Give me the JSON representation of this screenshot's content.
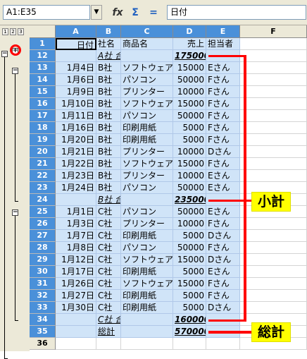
{
  "toolbar": {
    "name_box": "A1:E35",
    "function_wizard_icon": "fx-icon",
    "sum_icon": "sigma-icon",
    "equals_icon": "equals-icon",
    "sum_glyph": "Σ",
    "equals_glyph": "=",
    "fx_glyph": "fx",
    "formula_value": "日付"
  },
  "outline": {
    "levels": [
      "1",
      "2",
      "3"
    ],
    "collapse_glyph": "−",
    "expand_glyph": "+"
  },
  "columns": [
    "A",
    "B",
    "C",
    "D",
    "E",
    "F"
  ],
  "rows": [
    {
      "num": "1",
      "cells": [
        "日付",
        "社名",
        "商品名",
        "売上",
        "担当者"
      ]
    },
    {
      "num": "12",
      "cells": [
        "",
        "A社 合計",
        "",
        "175000",
        ""
      ]
    },
    {
      "num": "13",
      "cells": [
        "1月4日",
        "B社",
        "ソフトウェア",
        "15000",
        "Eさん"
      ]
    },
    {
      "num": "14",
      "cells": [
        "1月6日",
        "B社",
        "パソコン",
        "50000",
        "Fさん"
      ]
    },
    {
      "num": "15",
      "cells": [
        "1月9日",
        "B社",
        "プリンター",
        "10000",
        "Fさん"
      ]
    },
    {
      "num": "16",
      "cells": [
        "1月10日",
        "B社",
        "ソフトウェア",
        "15000",
        "Fさん"
      ]
    },
    {
      "num": "17",
      "cells": [
        "1月11日",
        "B社",
        "パソコン",
        "50000",
        "Fさん"
      ]
    },
    {
      "num": "18",
      "cells": [
        "1月16日",
        "B社",
        "印刷用紙",
        "5000",
        "Fさん"
      ]
    },
    {
      "num": "19",
      "cells": [
        "1月20日",
        "B社",
        "印刷用紙",
        "5000",
        "Fさん"
      ]
    },
    {
      "num": "20",
      "cells": [
        "1月21日",
        "B社",
        "プリンター",
        "10000",
        "Dさん"
      ]
    },
    {
      "num": "21",
      "cells": [
        "1月22日",
        "B社",
        "ソフトウェア",
        "15000",
        "Fさん"
      ]
    },
    {
      "num": "22",
      "cells": [
        "1月23日",
        "B社",
        "プリンター",
        "10000",
        "Eさん"
      ]
    },
    {
      "num": "23",
      "cells": [
        "1月24日",
        "B社",
        "パソコン",
        "50000",
        "Eさん"
      ]
    },
    {
      "num": "24",
      "cells": [
        "",
        "B社 合計",
        "",
        "235000",
        ""
      ]
    },
    {
      "num": "25",
      "cells": [
        "1月1日",
        "C社",
        "パソコン",
        "50000",
        "Eさん"
      ]
    },
    {
      "num": "26",
      "cells": [
        "1月3日",
        "C社",
        "プリンター",
        "10000",
        "Fさん"
      ]
    },
    {
      "num": "27",
      "cells": [
        "1月7日",
        "C社",
        "印刷用紙",
        "5000",
        "Dさん"
      ]
    },
    {
      "num": "28",
      "cells": [
        "1月8日",
        "C社",
        "パソコン",
        "50000",
        "Fさん"
      ]
    },
    {
      "num": "29",
      "cells": [
        "1月12日",
        "C社",
        "ソフトウェア",
        "15000",
        "Dさん"
      ]
    },
    {
      "num": "30",
      "cells": [
        "1月17日",
        "C社",
        "印刷用紙",
        "5000",
        "Eさん"
      ]
    },
    {
      "num": "31",
      "cells": [
        "1月26日",
        "C社",
        "ソフトウェア",
        "15000",
        "Fさん"
      ]
    },
    {
      "num": "32",
      "cells": [
        "1月27日",
        "C社",
        "印刷用紙",
        "5000",
        "Fさん"
      ]
    },
    {
      "num": "33",
      "cells": [
        "1月30日",
        "C社",
        "印刷用紙",
        "5000",
        "Dさん"
      ]
    },
    {
      "num": "34",
      "cells": [
        "",
        "C社 合計",
        "",
        "160000",
        ""
      ]
    },
    {
      "num": "35",
      "cells": [
        "",
        "総計",
        "",
        "570000",
        ""
      ]
    },
    {
      "num": "36",
      "cells": [
        "",
        "",
        "",
        "",
        ""
      ]
    }
  ],
  "annotations": {
    "subtotal_label": "小計",
    "grand_total_label": "総計",
    "accent_color": "#ff0000",
    "label_bg": "#ffff00"
  }
}
